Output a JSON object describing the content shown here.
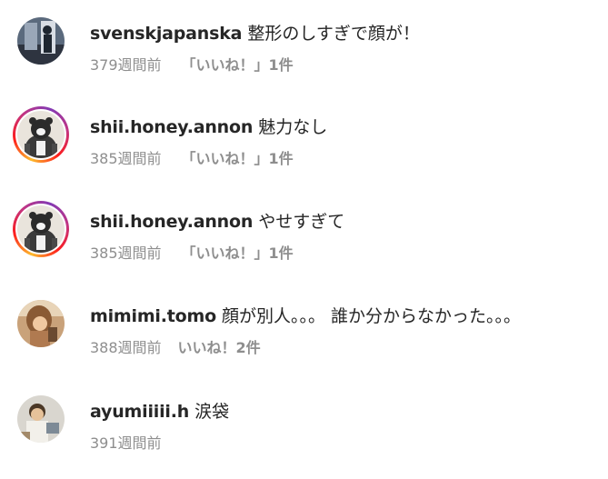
{
  "comments": [
    {
      "username": "svenskjapanska",
      "text": "整形のしすぎで顔が！",
      "time": "379週間前",
      "likes": "「いいね！」1件",
      "story_ring": false
    },
    {
      "username": "shii.honey.annon",
      "text": "魅力なし",
      "time": "385週間前",
      "likes": "「いいね！」1件",
      "story_ring": true
    },
    {
      "username": "shii.honey.annon",
      "text": "やせすぎて",
      "time": "385週間前",
      "likes": "「いいね！」1件",
      "story_ring": true
    },
    {
      "username": "mimimi.tomo",
      "text": "顔が別人。。。 誰か分からなかった。。。",
      "time": "388週間前",
      "likes": "いいね！2件",
      "story_ring": false
    },
    {
      "username": "ayumiiiii.h",
      "text": "涙袋",
      "time": "391週間前",
      "likes": "",
      "story_ring": false
    }
  ],
  "colors": {
    "text": "#262626",
    "secondary": "#8e8e8e",
    "story_ring_start": "#fdbb2d",
    "story_ring_end": "#c13584"
  }
}
